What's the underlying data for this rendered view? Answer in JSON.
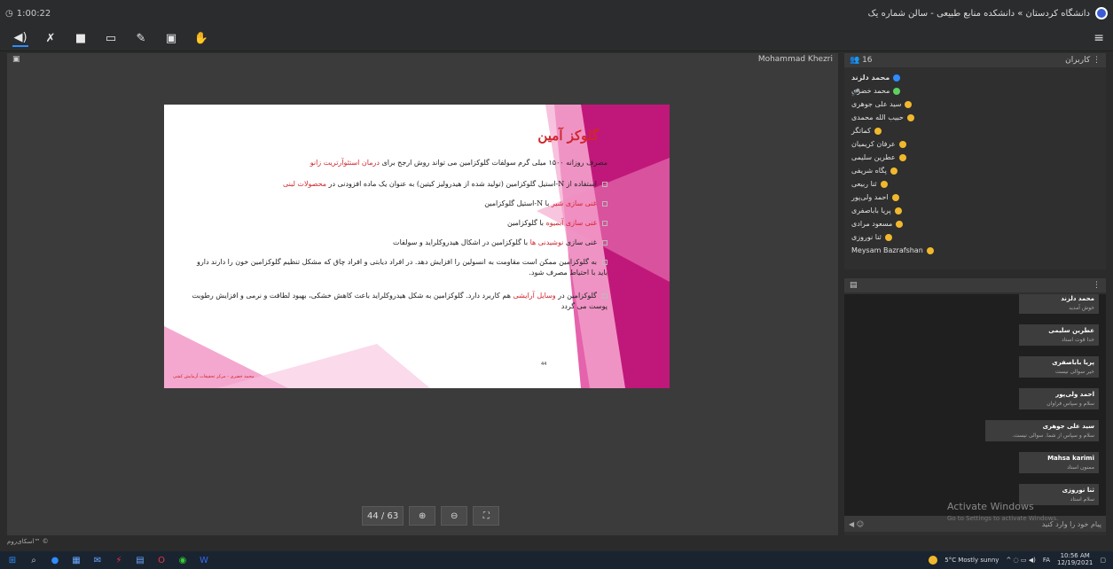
{
  "topbar": {
    "timer": "1:00:22",
    "room_title": "دانشگاه کردستان » دانشکده منابع طبیعی - سالن شماره یک"
  },
  "toolbar": {
    "icons": [
      "speaker-icon",
      "mic-muted-icon",
      "camera-icon",
      "screen-share-icon",
      "pen-icon",
      "presentation-icon",
      "hand-icon"
    ]
  },
  "stage": {
    "presenter": "Mohammad Khezri"
  },
  "slide": {
    "title": "گلوکز آمین",
    "bullets": [
      {
        "pre": "مصرف روزانه ۱۵۰۰ میلی گرم سولفات گلوکزامین می تواند روش ارجح برای ",
        "red": "درمان استئوآرتریت زانو",
        "post": ""
      },
      {
        "pre": "استفاده از N-استیل گلوکزامین (تولید شده از هیدرولیز کیتین) به عنوان یک ماده افزودنی در ",
        "red": "محصولات لبنی",
        "post": ""
      },
      {
        "pre": "",
        "red": "غنی سازی شیر",
        "post": " با N-استیل گلوکزامین"
      },
      {
        "pre": "",
        "red": "غنی سازی آبمیوه",
        "post": " با گلوکزامین"
      },
      {
        "pre": "غنی سازی ",
        "red": "نوشیدنی ها",
        "post": " با گلوکزامین در اشکال هیدروکلراید و سولفات"
      },
      {
        "pre": "به گلوکزامین ممکن است مقاومت به انسولین را افزایش دهد. در افراد دیابتی و افراد چاق که مشکل تنظیم گلوکزامین خون را دارند دارو باید با احتیاط مصرف شود.",
        "red": "",
        "post": ""
      },
      {
        "pre": "گلوکزامین در ",
        "red": "وسایل آرایشی",
        "post": " هم کاربرد دارد. گلوکزامین به شکل هیدروکلراید باعث کاهش خشکی، بهبود لطافت و نرمی و افزایش رطوبت پوست می گردد"
      }
    ],
    "footer": "محمد خضری - مرکز تحقیقات آزمایش کشی",
    "page_number": "44"
  },
  "pager": {
    "current": "44 / 63"
  },
  "users": {
    "count": "16",
    "title": "کاربران",
    "list": [
      {
        "name": "محمد دلزند",
        "bold": true,
        "color": "#2e8cff"
      },
      {
        "name": "محمد خضری",
        "bold": false,
        "color": "#5ed05e"
      },
      {
        "name": "سید علی جوهری",
        "bold": false,
        "color": "#f1b82d"
      },
      {
        "name": "حبیب الله محمدی",
        "bold": false,
        "color": "#f1b82d"
      },
      {
        "name": "کماتگر",
        "bold": false,
        "color": "#f1b82d"
      },
      {
        "name": "عرفان کریمیان",
        "bold": false,
        "color": "#f1b82d"
      },
      {
        "name": "عطرین سلیمی",
        "bold": false,
        "color": "#f1b82d"
      },
      {
        "name": "پگاه شریفی",
        "bold": false,
        "color": "#f1b82d"
      },
      {
        "name": "ثنا ربیعی",
        "bold": false,
        "color": "#f1b82d"
      },
      {
        "name": "احمد ولی‌پور",
        "bold": false,
        "color": "#f1b82d"
      },
      {
        "name": "پریا باباصفری",
        "bold": false,
        "color": "#f1b82d"
      },
      {
        "name": "مسعود مرادی",
        "bold": false,
        "color": "#f1b82d"
      },
      {
        "name": "ثنا نوروزی",
        "bold": false,
        "color": "#f1b82d"
      },
      {
        "name": "Meysam Bazrafshan",
        "bold": false,
        "color": "#f1b82d"
      }
    ]
  },
  "chat": {
    "messages": [
      {
        "name": "محمد دلزند",
        "text": "خوش آمدید"
      },
      {
        "name": "عطرین سلیمی",
        "text": "خدا قوت استاد"
      },
      {
        "name": "پریا باباصفری",
        "text": "خیر سوالی نیست"
      },
      {
        "name": "احمد ولی‌پور",
        "text": "سلام و سپاس فراوان"
      },
      {
        "name": "سید علی جوهری",
        "text": "سلام و سپاس از شما. سوالی نیست."
      },
      {
        "name": "Mahsa karimi",
        "text": "ممنون استاد"
      },
      {
        "name": "ثنا نوروزی",
        "text": "سلام استاد"
      }
    ],
    "input_placeholder": "پیام خود را وارد کنید"
  },
  "watermark": {
    "line1": "Activate Windows",
    "line2": "Go to Settings to activate Windows."
  },
  "skyroom": "اسکای‌روم™ ©",
  "taskbar": {
    "weather": "5°C  Mostly sunny",
    "lang": "FA",
    "time": "10:56 AM",
    "date": "12/19/2021"
  }
}
